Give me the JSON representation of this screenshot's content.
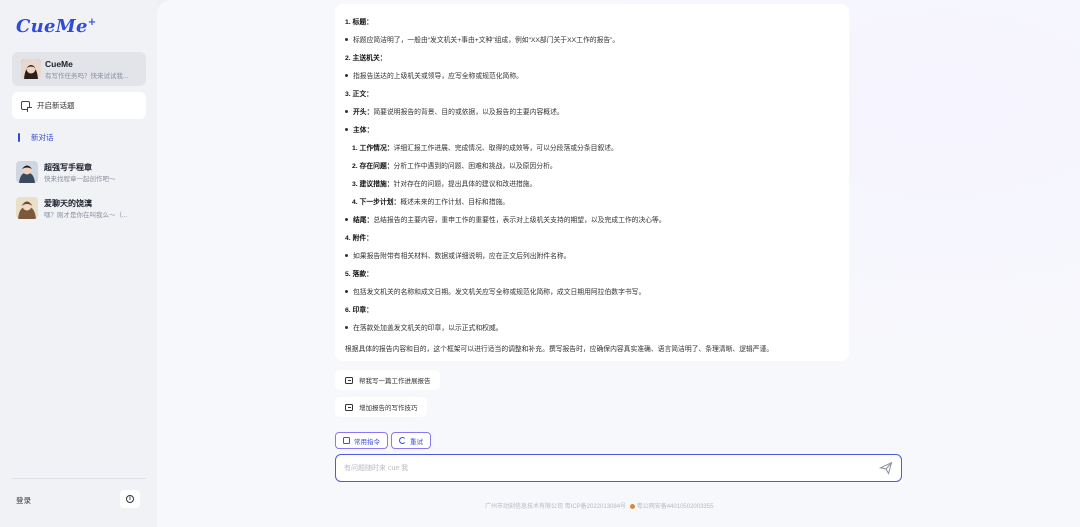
{
  "sidebar": {
    "logo": "CueMe",
    "logo_mark": "+",
    "agent": {
      "name": "CueMe",
      "subtitle": "有写作任务吗？快来试试我..."
    },
    "new_chat_label": "开启新话题",
    "current_chat_label": "新对话",
    "chats": [
      {
        "title": "超强写手程章",
        "subtitle": "快来找程章一起创作吧～"
      },
      {
        "title": "爱聊天的饶漓",
        "subtitle": "嘿？刚才是你在叫我么～（..."
      }
    ],
    "login_label": "登录"
  },
  "message": {
    "lines": [
      {
        "type": "heading",
        "text": "1. 标题："
      },
      {
        "type": "bullet",
        "text": "标题应简洁明了，一般由“发文机关+事由+文种”组成，例如“XX部门关于XX工作的报告”。"
      },
      {
        "type": "heading",
        "text": "2. 主送机关："
      },
      {
        "type": "bullet",
        "text": "指报告送达的上级机关或领导，应写全称或规范化简称。"
      },
      {
        "type": "heading",
        "text": "3. 正文："
      },
      {
        "type": "bullet-bold",
        "bold": "开头：",
        "text": "简要说明报告的背景、目的或依据，以及报告的主要内容概述。"
      },
      {
        "type": "bullet-bold",
        "bold": "主体：",
        "text": ""
      },
      {
        "type": "sub",
        "bold": "1. 工作情况：",
        "text": "详细汇报工作进展、完成情况、取得的成效等，可以分段落或分条目叙述。"
      },
      {
        "type": "sub",
        "bold": "2. 存在问题：",
        "text": "分析工作中遇到的问题、困难和挑战，以及原因分析。"
      },
      {
        "type": "sub",
        "bold": "3. 建议措施：",
        "text": "针对存在的问题，提出具体的建议和改进措施。"
      },
      {
        "type": "sub",
        "bold": "4. 下一步计划：",
        "text": "概述未来的工作计划、目标和措施。"
      },
      {
        "type": "bullet-bold",
        "bold": "结尾：",
        "text": "总结报告的主要内容，重申工作的重要性，表示对上级机关支持的期望，以及完成工作的决心等。"
      },
      {
        "type": "heading",
        "text": "4. 附件："
      },
      {
        "type": "bullet",
        "text": "如果报告附带有相关材料、数据或详细说明，应在正文后列出附件名称。"
      },
      {
        "type": "heading",
        "text": "5. 落款："
      },
      {
        "type": "bullet",
        "text": "包括发文机关的名称和成文日期。发文机关应写全称或规范化简称，成文日期用阿拉伯数字书写。"
      },
      {
        "type": "heading",
        "text": "6. 印章："
      },
      {
        "type": "bullet",
        "text": "在落款处加盖发文机关的印章，以示正式和权威。"
      },
      {
        "type": "plain",
        "text": "根据具体的报告内容和目的，这个框架可以进行适当的调整和补充。撰写报告时，应确保内容真实准确、语言简洁明了、条理清晰、逻辑严谨。"
      }
    ]
  },
  "suggestions": [
    {
      "label": "帮我写一篇工作进展报告"
    },
    {
      "label": "增加报告的写作技巧"
    }
  ],
  "actions": {
    "common_commands": "常用指令",
    "retry": "重试"
  },
  "input": {
    "placeholder": "有问题随时来 cue 我"
  },
  "footer": {
    "company": "广州市动刻信息技术有限公司 粤ICP备2022013084号",
    "police": "粤公网安备44010502003355"
  },
  "colors": {
    "accent": "#2f4bd8",
    "input_border": "#4d5be0",
    "pill_border": "#8a78f0"
  }
}
